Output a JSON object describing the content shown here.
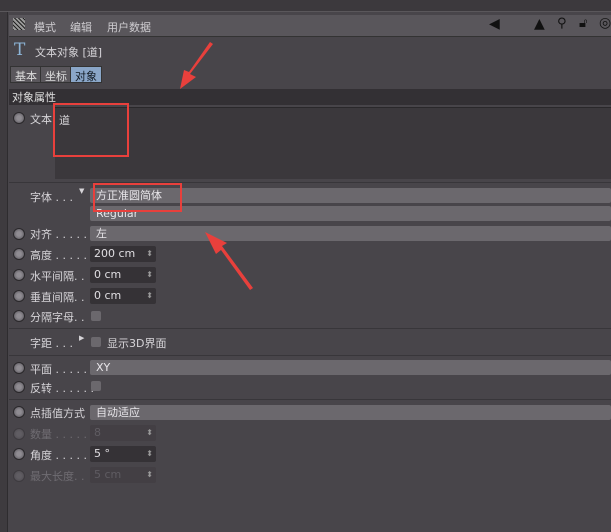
{
  "menu": {
    "items": [
      "模式",
      "编辑",
      "用户数据"
    ]
  },
  "header": {
    "title": "文本对象 [道]"
  },
  "tabs": [
    {
      "label": "基本"
    },
    {
      "label": "坐标"
    },
    {
      "label": "对象",
      "active": true
    }
  ],
  "section": "对象属性",
  "fields": {
    "text": {
      "label": "文本",
      "value": "道"
    },
    "font": {
      "label": "字体 . . .",
      "value": "方正准圆简体",
      "style": "Regular"
    },
    "align": {
      "label": "对齐 . . . . . .",
      "value": "左"
    },
    "height": {
      "label": "高度 . . . . . .",
      "value": "200 cm"
    },
    "hspace": {
      "label": "水平间隔. .",
      "value": "0 cm"
    },
    "vspace": {
      "label": "垂直间隔. .",
      "value": "0 cm"
    },
    "separate": {
      "label": "分隔字母. ."
    },
    "kerning": {
      "label": "字距 . . .",
      "show3d": "显示3D界面"
    },
    "plane": {
      "label": "平面 . . . . . .",
      "value": "XY"
    },
    "reverse": {
      "label": "反转 . . . . . ."
    },
    "interp": {
      "label": "点插值方式",
      "value": "自动适应"
    },
    "count": {
      "label": "数量 . . . . . .",
      "value": "8"
    },
    "angle": {
      "label": "角度 . . . . . .",
      "value": "5 °"
    },
    "maxlen": {
      "label": "最大长度. .",
      "value": "5 cm"
    }
  },
  "colors": {
    "annotation": "#e8403c",
    "active_tab": "#8aa6c8"
  }
}
